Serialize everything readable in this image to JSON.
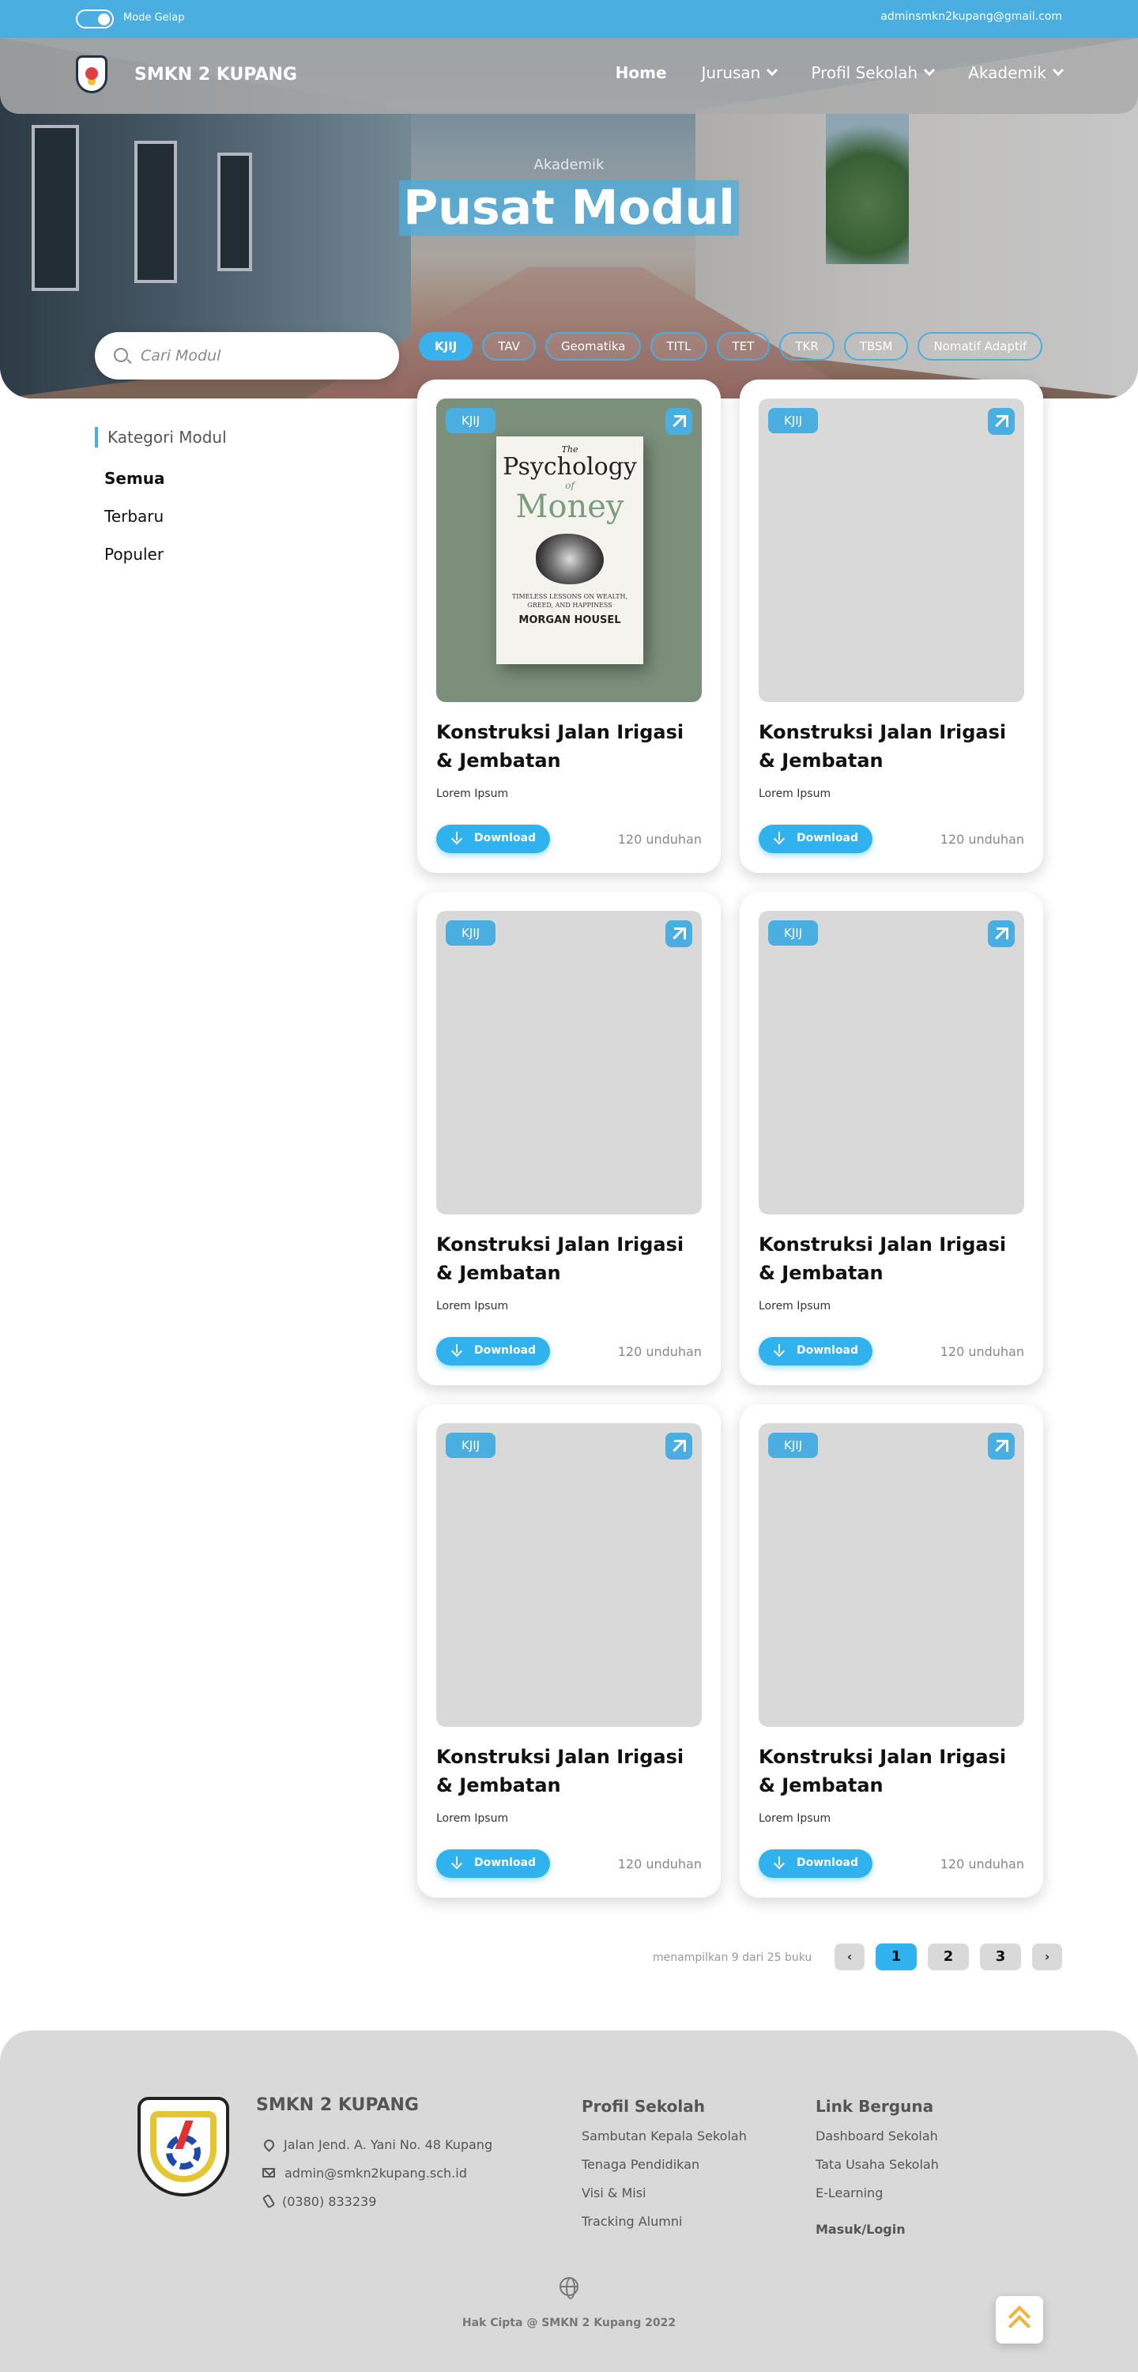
{
  "topbar": {
    "mode_label": "Mode Gelap",
    "email": "adminsmkn2kupang@gmail.com"
  },
  "header": {
    "brand": "SMKN 2 KUPANG",
    "nav": [
      {
        "label": "Home"
      },
      {
        "label": "Jurusan"
      },
      {
        "label": "Profil Sekolah"
      },
      {
        "label": "Akademik"
      }
    ]
  },
  "hero": {
    "breadcrumb": "Akademik",
    "title": "Pusat Modul"
  },
  "search": {
    "placeholder": "Cari Modul"
  },
  "filters": [
    "KJIJ",
    "TAV",
    "Geomatika",
    "TITL",
    "TET",
    "TKR",
    "TBSM",
    "Nomatif Adaptif"
  ],
  "sidebar": {
    "title": "Kategori Modul",
    "items": [
      {
        "label": "Semua"
      },
      {
        "label": "Terbaru"
      },
      {
        "label": "Populer"
      }
    ]
  },
  "book_cover": {
    "the": "The",
    "psychology": "Psychology",
    "of": "of",
    "money": "Money",
    "subtitle": "TIMELESS LESSONS ON WEALTH, GREED, AND HAPPINESS",
    "author": "MORGAN HOUSEL"
  },
  "cards": [
    {
      "badge": "KJIJ",
      "title": "Konstruksi Jalan Irigasi & Jembatan",
      "desc": "Lorem Ipsum",
      "button": "Download",
      "downloads": "120 unduhan"
    },
    {
      "badge": "KJIJ",
      "title": "Konstruksi Jalan Irigasi & Jembatan",
      "desc": "Lorem Ipsum",
      "button": "Download",
      "downloads": "120 unduhan"
    },
    {
      "badge": "KJIJ",
      "title": "Konstruksi Jalan Irigasi & Jembatan",
      "desc": "Lorem Ipsum",
      "button": "Download",
      "downloads": "120 unduhan"
    },
    {
      "badge": "KJIJ",
      "title": "Konstruksi Jalan Irigasi & Jembatan",
      "desc": "Lorem Ipsum",
      "button": "Download",
      "downloads": "120 unduhan"
    },
    {
      "badge": "KJIJ",
      "title": "Konstruksi Jalan Irigasi & Jembatan",
      "desc": "Lorem Ipsum",
      "button": "Download",
      "downloads": "120 unduhan"
    },
    {
      "badge": "KJIJ",
      "title": "Konstruksi Jalan Irigasi & Jembatan",
      "desc": "Lorem Ipsum",
      "button": "Download",
      "downloads": "120 unduhan"
    }
  ],
  "pagination": {
    "info": "menampilkan 9 dari 25 buku",
    "prev": "‹",
    "pages": [
      "1",
      "2",
      "3"
    ],
    "next": "›"
  },
  "footer": {
    "brand": "SMKN 2 KUPANG",
    "address": "Jalan Jend. A. Yani No. 48 Kupang",
    "email": "admin@smkn2kupang.sch.id",
    "phone": "(0380) 833239",
    "profil_title": "Profil Sekolah",
    "profil_links": [
      "Sambutan Kepala Sekolah",
      "Tenaga Pendidikan",
      "Visi & Misi",
      "Tracking Alumni"
    ],
    "links_title": "Link Berguna",
    "links": [
      "Dashboard Sekolah",
      "Tata Usaha Sekolah",
      "E-Learning"
    ],
    "login": "Masuk/Login",
    "copyright": "Hak Cipta @ SMKN 2 Kupang 2022"
  },
  "colors": {
    "accent": "#4aaee0",
    "button": "#30b2ee",
    "footer_bg": "#d9d9d9",
    "scroll_top_arrow": "#f2b33d"
  }
}
